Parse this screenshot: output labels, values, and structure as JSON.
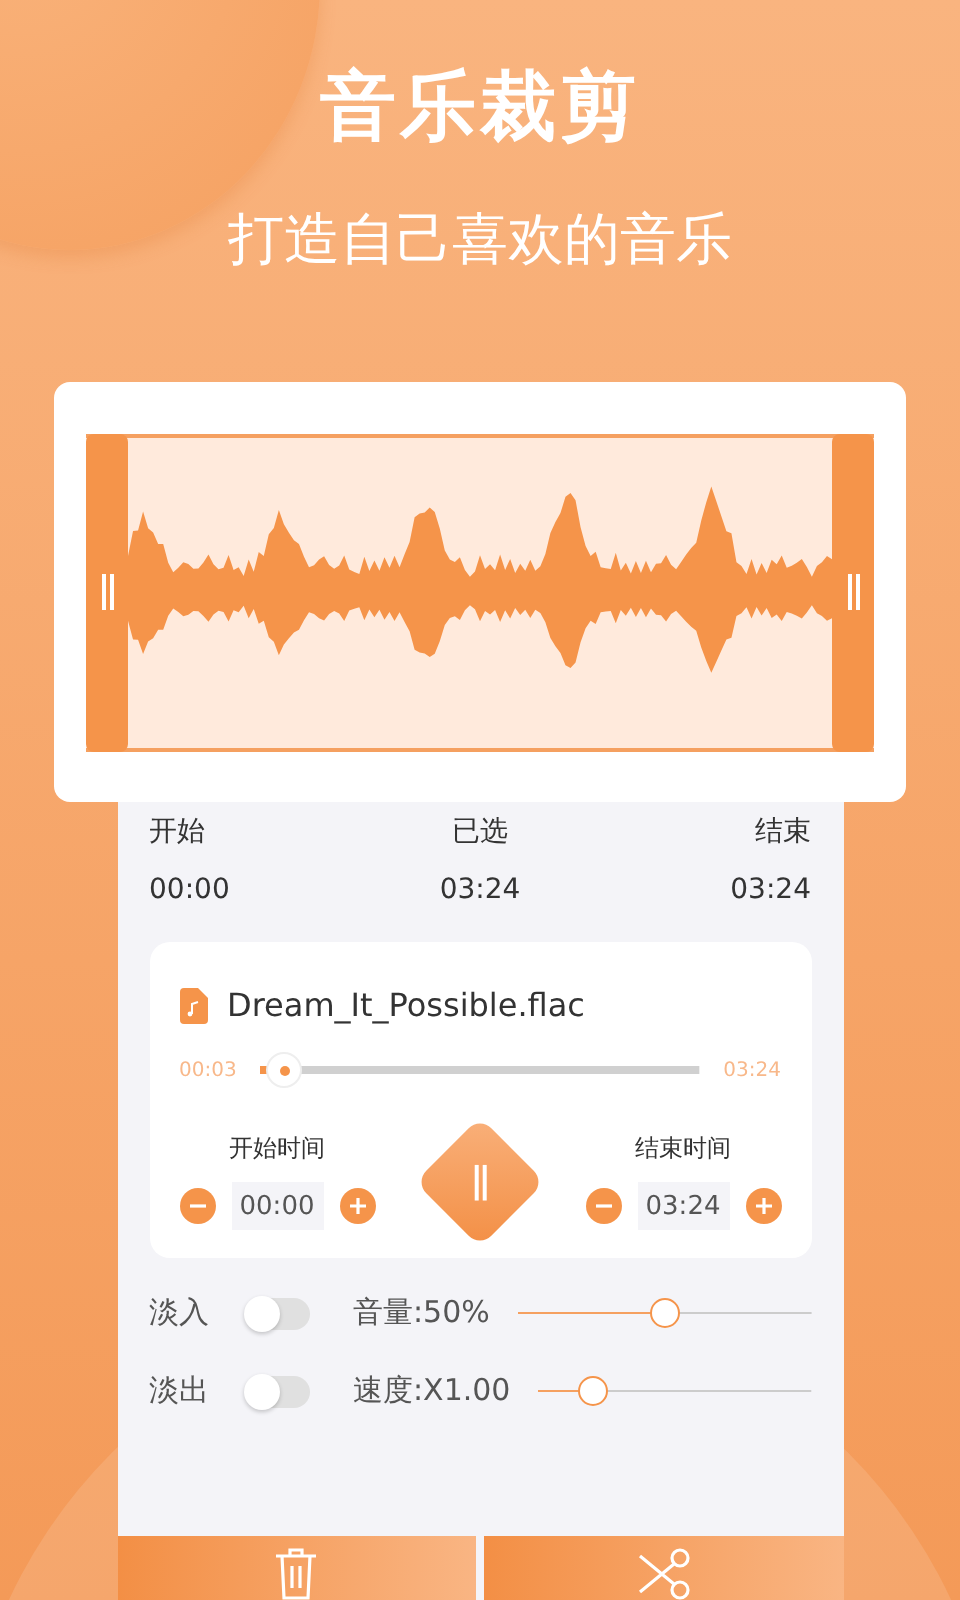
{
  "header": {
    "title": "音乐裁剪",
    "subtitle": "打造自己喜欢的音乐"
  },
  "selection": [
    {
      "label": "开始",
      "value": "00:00"
    },
    {
      "label": "已选",
      "value": "03:24"
    },
    {
      "label": "结束",
      "value": "03:24"
    }
  ],
  "player": {
    "file_name": "Dream_It_Possible.flac",
    "current": "00:03",
    "total": "03:24",
    "level": 0.015,
    "playing": true,
    "start": {
      "label": "开始时间",
      "value": "00:00"
    },
    "end": {
      "label": "结束时间",
      "value": "03:24"
    }
  },
  "settings": [
    {
      "fade_label": "淡入",
      "fade_on": false,
      "slider_label": "音量:50%",
      "level": 0.5
    },
    {
      "fade_label": "淡出",
      "fade_on": false,
      "slider_label": "速度:X1.00",
      "level": 0.2
    }
  ]
}
